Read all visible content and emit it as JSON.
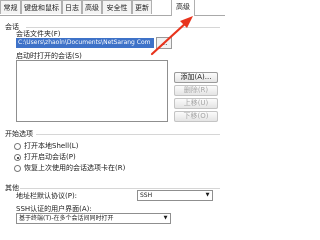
{
  "tabs": [
    "常规",
    "键盘和鼠标",
    "日志",
    "高级",
    "安全性",
    "更新",
    "高级"
  ],
  "session": {
    "section_title": "会话",
    "folder_label": "会话文件夹(F)",
    "folder_value": "C:\\Users\\zhaoln\\Documents\\NetSarang Com",
    "browse_label": "...",
    "startup_label": "启动时打开的会话(S)"
  },
  "side_buttons": {
    "add": "添加(A)...",
    "delete": "删除(R)",
    "move_up": "上移(U)",
    "move_down": "下移(O)"
  },
  "startup_options": {
    "section_title": "开始选项",
    "options": [
      "打开本地Shell(L)",
      "打开启动会话(P)",
      "恢复上次使用的会话选项卡在(R)"
    ]
  },
  "other": {
    "section_title": "其他",
    "address_bar_label": "地址栏默认协议(P):",
    "address_bar_value": "SSH",
    "ssh_label": "SSH认证的用户界面(A):",
    "ssh_value": "基于终端(T)-在多个会话间同时打开"
  },
  "colors": {
    "annotation": "#e8331c",
    "selection": "#3e72c8"
  }
}
